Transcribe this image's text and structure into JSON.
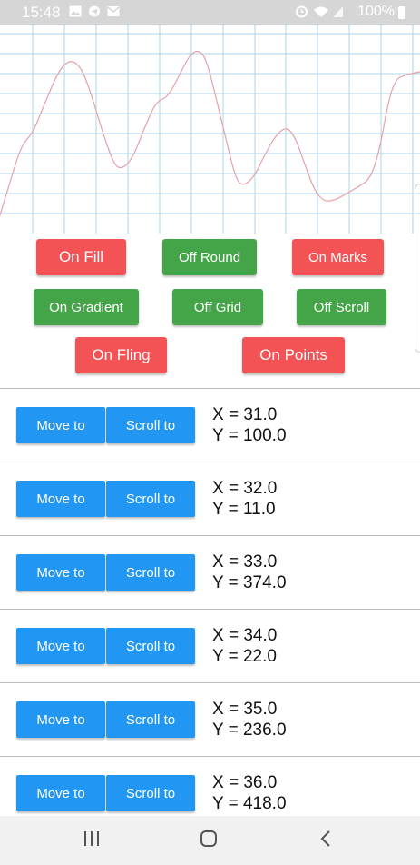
{
  "status_bar": {
    "time": "15:48",
    "battery_text": "100%",
    "left_icons": [
      "image-icon",
      "telegram-icon",
      "mail-icon"
    ],
    "right_icons": [
      "alarm-icon",
      "wifi-icon",
      "signal-icon",
      "battery-icon"
    ]
  },
  "chart_data": {
    "type": "line",
    "grid": true,
    "line_color": "#e6a0a8",
    "grid_color": "#a9d6e8"
  },
  "controls": {
    "row1": [
      {
        "label": "On Fill",
        "state": "on"
      },
      {
        "label": "Off Round",
        "state": "off"
      },
      {
        "label": "On Marks",
        "state": "on"
      }
    ],
    "row2": [
      {
        "label": "On Gradient",
        "state": "off"
      },
      {
        "label": "Off Grid",
        "state": "off"
      },
      {
        "label": "Off Scroll",
        "state": "off"
      }
    ],
    "row3": [
      {
        "label": "On Fling",
        "state": "on"
      },
      {
        "label": "On Points",
        "state": "on"
      }
    ]
  },
  "colors": {
    "red": "#f45356",
    "green": "#43a548",
    "blue": "#2196f3"
  },
  "list": [
    {
      "move_label": "Move to",
      "scroll_label": "Scroll to",
      "x": "X = 31.0",
      "y": "Y = 100.0"
    },
    {
      "move_label": "Move to",
      "scroll_label": "Scroll to",
      "x": "X = 32.0",
      "y": "Y = 11.0"
    },
    {
      "move_label": "Move to",
      "scroll_label": "Scroll to",
      "x": "X = 33.0",
      "y": "Y = 374.0"
    },
    {
      "move_label": "Move to",
      "scroll_label": "Scroll to",
      "x": "X = 34.0",
      "y": "Y = 22.0"
    },
    {
      "move_label": "Move to",
      "scroll_label": "Scroll to",
      "x": "X = 35.0",
      "y": "Y = 236.0"
    },
    {
      "move_label": "Move to",
      "scroll_label": "Scroll to",
      "x": "X = 36.0",
      "y": "Y = 418.0"
    }
  ],
  "nav_bar": {
    "icons": [
      "recents-icon",
      "home-icon",
      "back-icon"
    ]
  }
}
